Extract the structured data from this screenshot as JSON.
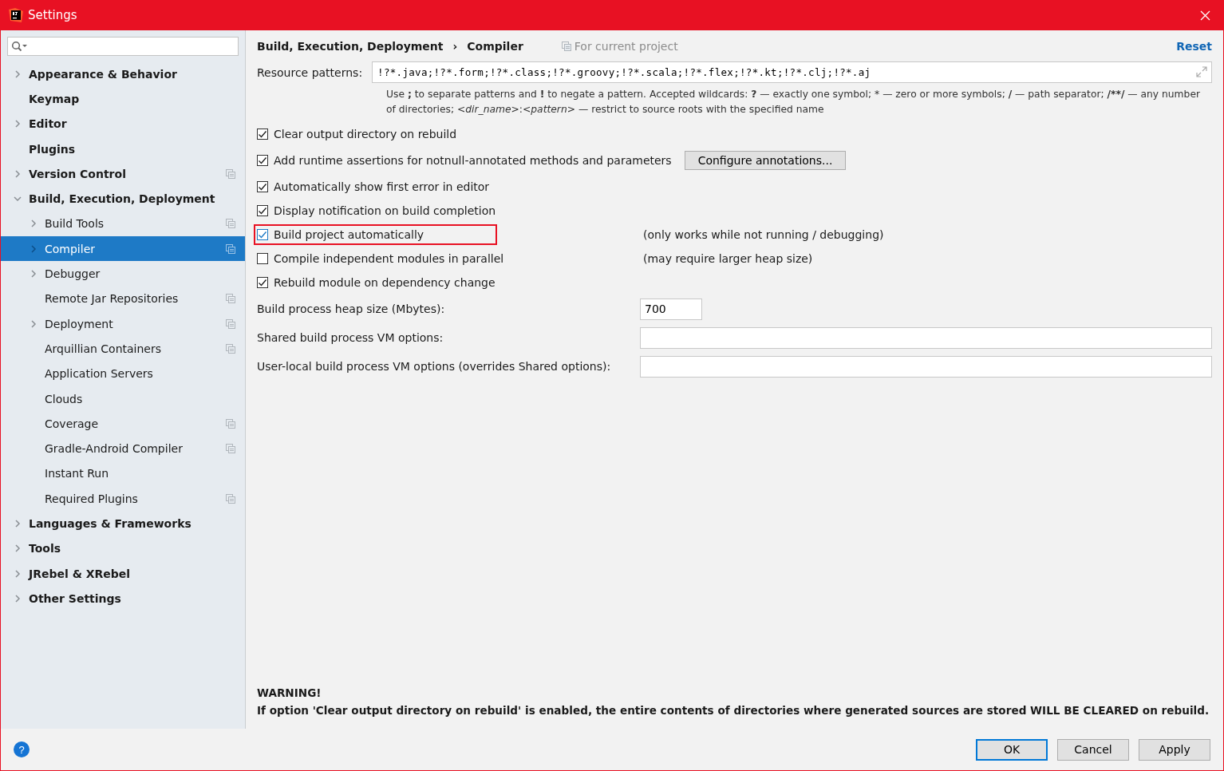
{
  "window": {
    "title": "Settings"
  },
  "sidebar": {
    "items": [
      {
        "label": "Appearance & Behavior",
        "expandable": true,
        "expanded": false,
        "project": false,
        "selected": false
      },
      {
        "label": "Keymap",
        "expandable": false,
        "project": false,
        "selected": false
      },
      {
        "label": "Editor",
        "expandable": true,
        "expanded": false,
        "project": false,
        "selected": false
      },
      {
        "label": "Plugins",
        "expandable": false,
        "project": false,
        "selected": false
      },
      {
        "label": "Version Control",
        "expandable": true,
        "expanded": false,
        "project": true,
        "selected": false
      },
      {
        "label": "Build, Execution, Deployment",
        "expandable": true,
        "expanded": true,
        "project": false,
        "selected": false,
        "children": [
          {
            "label": "Build Tools",
            "expandable": true,
            "expanded": false,
            "project": true,
            "selected": false
          },
          {
            "label": "Compiler",
            "expandable": true,
            "expanded": false,
            "project": true,
            "selected": true
          },
          {
            "label": "Debugger",
            "expandable": true,
            "expanded": false,
            "project": false,
            "selected": false
          },
          {
            "label": "Remote Jar Repositories",
            "expandable": false,
            "project": true,
            "selected": false
          },
          {
            "label": "Deployment",
            "expandable": true,
            "expanded": false,
            "project": true,
            "selected": false
          },
          {
            "label": "Arquillian Containers",
            "expandable": false,
            "project": true,
            "selected": false
          },
          {
            "label": "Application Servers",
            "expandable": false,
            "project": false,
            "selected": false
          },
          {
            "label": "Clouds",
            "expandable": false,
            "project": false,
            "selected": false
          },
          {
            "label": "Coverage",
            "expandable": false,
            "project": true,
            "selected": false
          },
          {
            "label": "Gradle-Android Compiler",
            "expandable": false,
            "project": true,
            "selected": false
          },
          {
            "label": "Instant Run",
            "expandable": false,
            "project": false,
            "selected": false
          },
          {
            "label": "Required Plugins",
            "expandable": false,
            "project": true,
            "selected": false
          }
        ]
      },
      {
        "label": "Languages & Frameworks",
        "expandable": true,
        "expanded": false,
        "project": false,
        "selected": false
      },
      {
        "label": "Tools",
        "expandable": true,
        "expanded": false,
        "project": false,
        "selected": false
      },
      {
        "label": "JRebel & XRebel",
        "expandable": true,
        "expanded": false,
        "project": false,
        "selected": false
      },
      {
        "label": "Other Settings",
        "expandable": true,
        "expanded": false,
        "project": false,
        "selected": false
      }
    ]
  },
  "breadcrumb": [
    "Build, Execution, Deployment",
    "›",
    "Compiler"
  ],
  "scope": "For current project",
  "reset": "Reset",
  "resource_patterns": {
    "label": "Resource patterns:",
    "value": "!?*.java;!?*.form;!?*.class;!?*.groovy;!?*.scala;!?*.flex;!?*.kt;!?*.clj;!?*.aj",
    "hint": [
      {
        "text": "Use ",
        "kind": "text"
      },
      {
        "text": ";",
        "kind": "symbol"
      },
      {
        "text": " to separate patterns and ",
        "kind": "text"
      },
      {
        "text": "!",
        "kind": "symbol"
      },
      {
        "text": " to negate a pattern. Accepted wildcards: ",
        "kind": "text"
      },
      {
        "text": "?",
        "kind": "symbol"
      },
      {
        "text": " — exactly one symbol; * — zero or more symbols; ",
        "kind": "text"
      },
      {
        "text": "/",
        "kind": "symbol"
      },
      {
        "text": " — path separator; ",
        "kind": "text"
      },
      {
        "text": "/**/",
        "kind": "symbol"
      },
      {
        "text": " — any number of directories; ",
        "kind": "text"
      },
      {
        "text": "<dir_name>",
        "kind": "placeholder"
      },
      {
        "text": ":",
        "kind": "text"
      },
      {
        "text": "<pattern>",
        "kind": "placeholder"
      },
      {
        "text": " — restrict to source roots with the specified name",
        "kind": "text"
      }
    ]
  },
  "options": [
    {
      "label": "Clear output directory on rebuild",
      "checked": true,
      "highlighted": false
    },
    {
      "label": "Add runtime assertions for notnull-annotated methods and parameters",
      "checked": true,
      "highlighted": false,
      "button": "Configure annotations..."
    },
    {
      "label": "Automatically show first error in editor",
      "checked": true,
      "highlighted": false
    },
    {
      "label": "Display notification on build completion",
      "checked": true,
      "highlighted": false
    },
    {
      "label": "Build project automatically",
      "checked": true,
      "highlighted": true,
      "note": "(only works while not running / debugging)"
    },
    {
      "label": "Compile independent modules in parallel",
      "checked": false,
      "highlighted": false,
      "note": "(may require larger heap size)"
    },
    {
      "label": "Rebuild module on dependency change",
      "checked": true,
      "highlighted": false
    }
  ],
  "fields": [
    {
      "label": "Build process heap size (Mbytes):",
      "value": "700",
      "kind": "short"
    },
    {
      "label": "Shared build process VM options:",
      "kind": "full"
    },
    {
      "label": "User-local build process VM options (overrides Shared options):",
      "kind": "full"
    }
  ],
  "warning": {
    "title": "WARNING!",
    "text": "If option 'Clear output directory on rebuild' is enabled, the entire contents of directories where generated sources are stored WILL BE CLEARED on rebuild."
  },
  "help": "?",
  "buttons": [
    {
      "label": "OK",
      "default": true
    },
    {
      "label": "Cancel",
      "default": false
    },
    {
      "label": "Apply",
      "default": false
    }
  ]
}
